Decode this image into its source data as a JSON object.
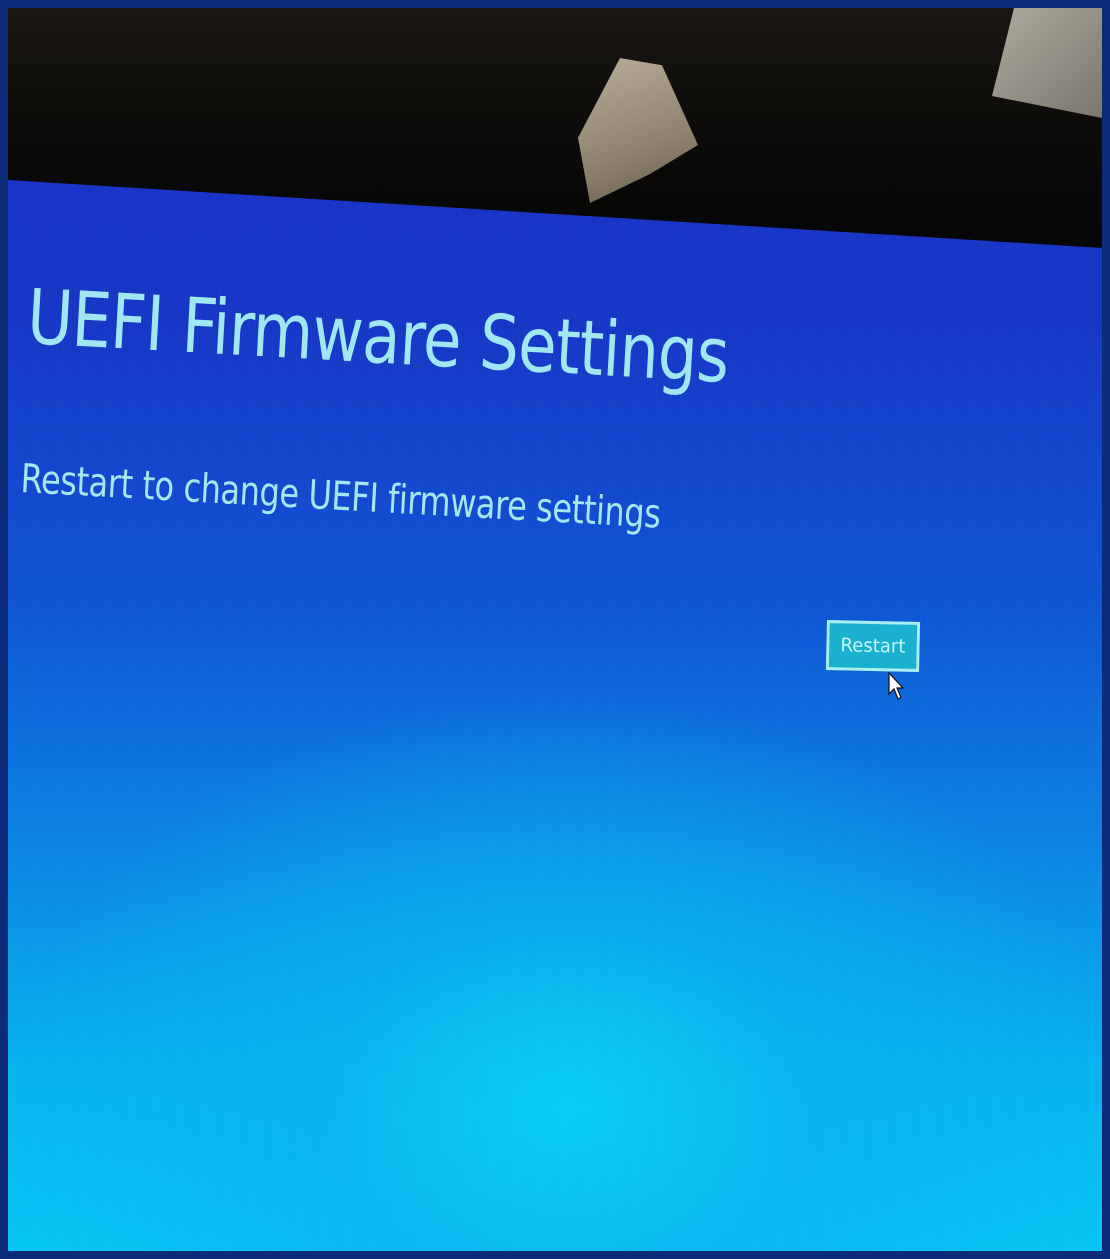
{
  "page": {
    "title": "UEFI Firmware Settings",
    "subtitle": "Restart to change UEFI firmware settings"
  },
  "actions": {
    "restart_label": "Restart"
  },
  "colors": {
    "text_accent": "#9fe7f2",
    "screen_top": "#1a2fc9",
    "screen_bottom": "#03c6f6",
    "button_fill": "#1ab0cf",
    "button_border": "#a8eef2"
  },
  "icons": {
    "pointer": "mouse-pointer-icon"
  }
}
